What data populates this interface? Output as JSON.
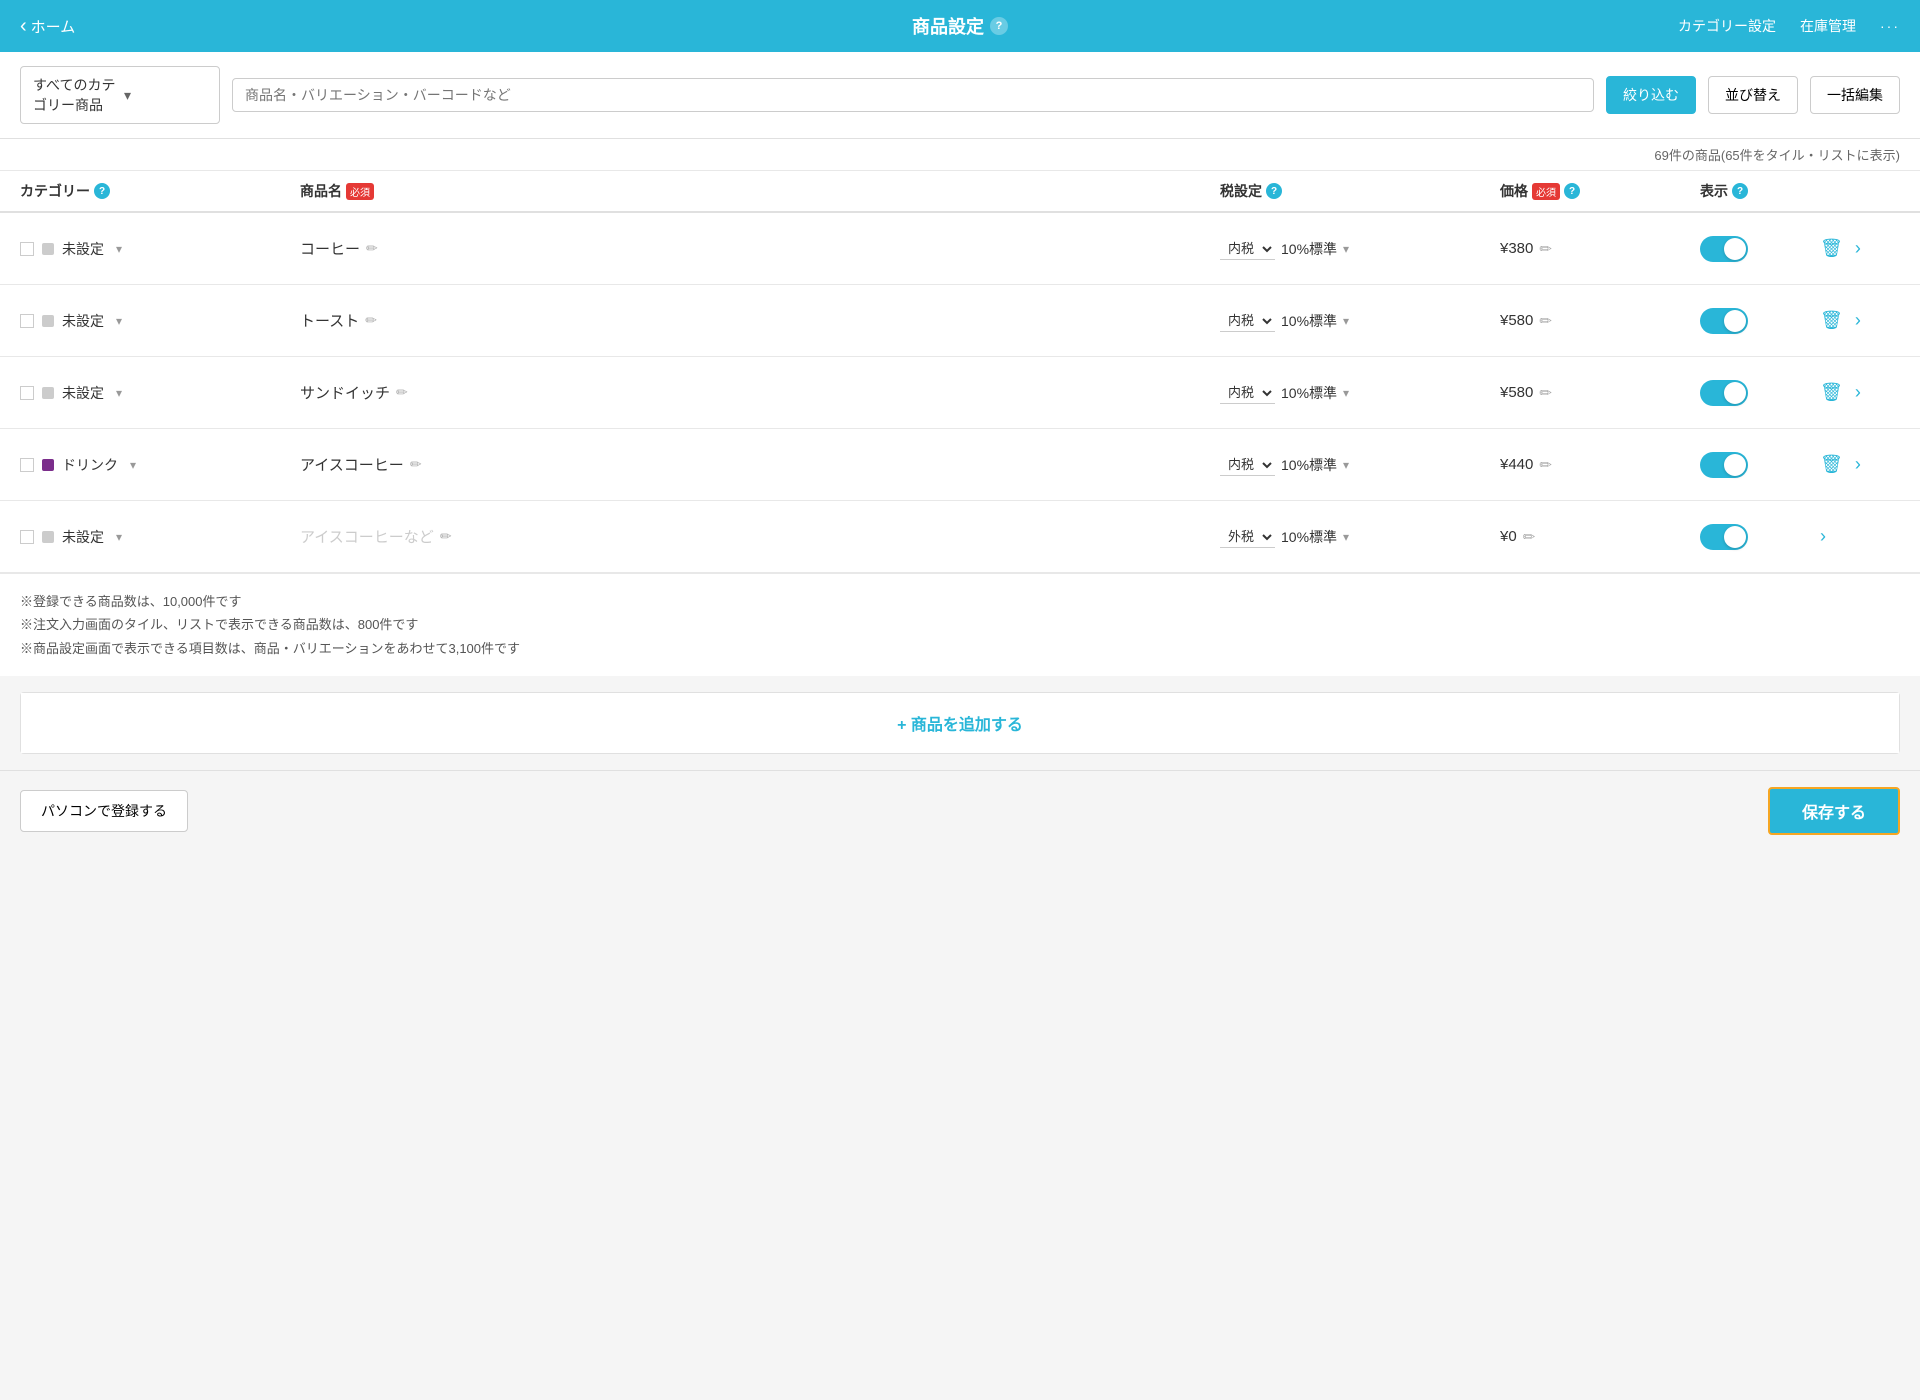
{
  "header": {
    "back_label": "ホーム",
    "title": "商品設定",
    "category_setting": "カテゴリー設定",
    "inventory_management": "在庫管理",
    "more": "···"
  },
  "toolbar": {
    "category_select_label": "すべてのカテゴリー商品",
    "search_placeholder": "商品名・バリエーション・バーコードなど",
    "filter_label": "絞り込む",
    "sort_label": "並び替え",
    "bulk_edit_label": "一括編集"
  },
  "count_text": "69件の商品(65件をタイル・リストに表示)",
  "table": {
    "col_category": "カテゴリー",
    "col_product": "商品名",
    "col_tax": "税設定",
    "col_price": "価格",
    "col_display": "表示",
    "required": "必須"
  },
  "products": [
    {
      "category_color": "#ccc",
      "category_name": "未設定",
      "product_name": "コーヒー",
      "tax_type": "内税",
      "tax_rate": "10%標準",
      "price": "¥380",
      "is_placeholder": false
    },
    {
      "category_color": "#ccc",
      "category_name": "未設定",
      "product_name": "トースト",
      "tax_type": "内税",
      "tax_rate": "10%標準",
      "price": "¥580",
      "is_placeholder": false
    },
    {
      "category_color": "#ccc",
      "category_name": "未設定",
      "product_name": "サンドイッチ",
      "tax_type": "内税",
      "tax_rate": "10%標準",
      "price": "¥580",
      "is_placeholder": false
    },
    {
      "category_color": "#7b2d8b",
      "category_name": "ドリンク",
      "product_name": "アイスコーヒー",
      "tax_type": "内税",
      "tax_rate": "10%標準",
      "price": "¥440",
      "is_placeholder": false
    },
    {
      "category_color": "#ccc",
      "category_name": "未設定",
      "product_name": "アイスコーヒーなど",
      "tax_type": "外税",
      "tax_rate": "10%標準",
      "price": "¥0",
      "is_placeholder": true
    }
  ],
  "notes": [
    "※登録できる商品数は、10,000件です",
    "※注文入力画面のタイル、リストで表示できる商品数は、800件です",
    "※商品設定画面で表示できる項目数は、商品・バリエーションをあわせて3,100件です"
  ],
  "add_product_label": "+ 商品を追加する",
  "footer": {
    "register_pc_label": "パソコンで登録する",
    "save_label": "保存する"
  }
}
